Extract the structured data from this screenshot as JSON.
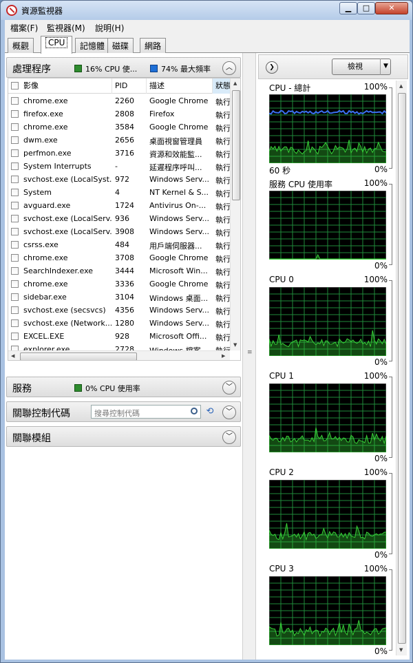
{
  "window": {
    "title": "資源監視器",
    "min_glyph": "▁",
    "max_glyph": "□",
    "close_glyph": "✕"
  },
  "menu": [
    "檔案(F)",
    "監視器(M)",
    "說明(H)"
  ],
  "tabs": [
    "概觀",
    "CPU",
    "記憶體",
    "磁碟",
    "網路"
  ],
  "active_tab": "CPU",
  "processes": {
    "title": "處理程序",
    "cpu_legend": "16% CPU 使...",
    "freq_legend": "74% 最大頻率",
    "cpu_color": "#2e8b2e",
    "freq_color": "#1e6fd6",
    "columns": [
      "影像",
      "PID",
      "描述",
      "狀態"
    ],
    "rows": [
      [
        "chrome.exe",
        "2260",
        "Google Chrome",
        "執行"
      ],
      [
        "firefox.exe",
        "2808",
        "Firefox",
        "執行"
      ],
      [
        "chrome.exe",
        "3584",
        "Google Chrome",
        "執行"
      ],
      [
        "dwm.exe",
        "2656",
        "桌面視窗管理員",
        "執行"
      ],
      [
        "perfmon.exe",
        "3716",
        "資源和效能監...",
        "執行"
      ],
      [
        "System Interrupts",
        "-",
        "延遲程序呼叫...",
        "執行"
      ],
      [
        "svchost.exe (LocalSyst...",
        "972",
        "Windows Serv...",
        "執行"
      ],
      [
        "System",
        "4",
        "NT Kernel & S...",
        "執行"
      ],
      [
        "avguard.exe",
        "1724",
        "Antivirus On-...",
        "執行"
      ],
      [
        "svchost.exe (LocalServ...",
        "936",
        "Windows Serv...",
        "執行"
      ],
      [
        "svchost.exe (LocalServ...",
        "3908",
        "Windows Serv...",
        "執行"
      ],
      [
        "csrss.exe",
        "484",
        "用戶端伺服器...",
        "執行"
      ],
      [
        "chrome.exe",
        "3708",
        "Google Chrome",
        "執行"
      ],
      [
        "SearchIndexer.exe",
        "3444",
        "Microsoft Win...",
        "執行"
      ],
      [
        "chrome.exe",
        "3336",
        "Google Chrome",
        "執行"
      ],
      [
        "sidebar.exe",
        "3104",
        "Windows 桌面...",
        "執行"
      ],
      [
        "svchost.exe (secsvcs)",
        "4356",
        "Windows Serv...",
        "執行"
      ],
      [
        "svchost.exe (Network...",
        "1280",
        "Windows Serv...",
        "執行"
      ],
      [
        "EXCEL.EXE",
        "928",
        "Microsoft Offi...",
        "執行"
      ],
      [
        "explorer.exe",
        "2728",
        "Windows 檔案...",
        "執行"
      ]
    ]
  },
  "services": {
    "title": "服務",
    "cpu_legend": "0% CPU 使用率",
    "color": "#2e8b2e"
  },
  "handles": {
    "title": "關聯控制代碼",
    "search_placeholder": "搜尋控制代碼"
  },
  "modules": {
    "title": "關聯模組"
  },
  "right": {
    "view_label": "檢視",
    "graphs": [
      {
        "title": "CPU - 總計",
        "max": "100%",
        "min": "0%",
        "left_label": "60 秒"
      },
      {
        "title": "服務 CPU 使用率",
        "max": "100%",
        "min": "0%",
        "left_label": ""
      },
      {
        "title": "CPU 0",
        "max": "100%",
        "min": "0%",
        "left_label": ""
      },
      {
        "title": "CPU 1",
        "max": "100%",
        "min": "0%",
        "left_label": ""
      },
      {
        "title": "CPU 2",
        "max": "100%",
        "min": "0%",
        "left_label": ""
      },
      {
        "title": "CPU 3",
        "max": "100%",
        "min": "0%",
        "left_label": ""
      }
    ],
    "graph_bg": "#000000",
    "grid_color": "#1f8a3a",
    "line_color": "#37d137",
    "freq_line_color": "#3b6ff0"
  }
}
